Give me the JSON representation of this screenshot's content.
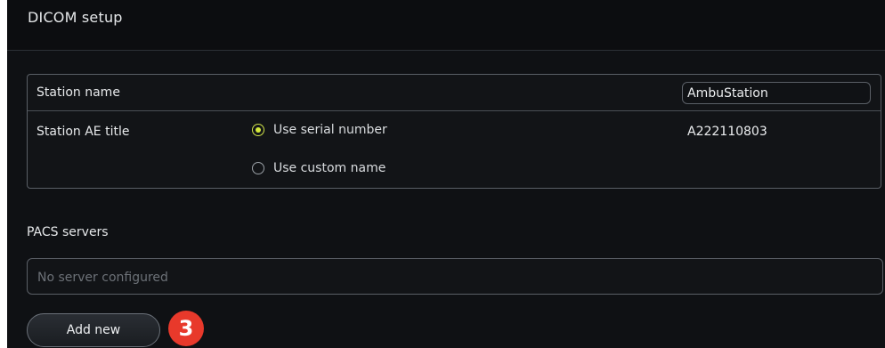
{
  "header": {
    "title": "DICOM setup"
  },
  "station": {
    "name_label": "Station name",
    "name_value": "AmbuStation",
    "ae_title_label": "Station AE title",
    "options": [
      {
        "label": "Use serial number",
        "selected": true
      },
      {
        "label": "Use custom name",
        "selected": false
      }
    ],
    "serial_number": "A222110803"
  },
  "pacs": {
    "title": "PACS servers",
    "empty_text": "No server configured",
    "add_label": "Add new"
  },
  "annotations": {
    "step_number": "3"
  },
  "colors": {
    "background": "#0f1114",
    "radio_accent": "#d4ea3a",
    "badge": "#e8392b"
  },
  "icons": {
    "radio_selected": "radio-selected-icon",
    "radio_unselected": "radio-unselected-icon"
  }
}
